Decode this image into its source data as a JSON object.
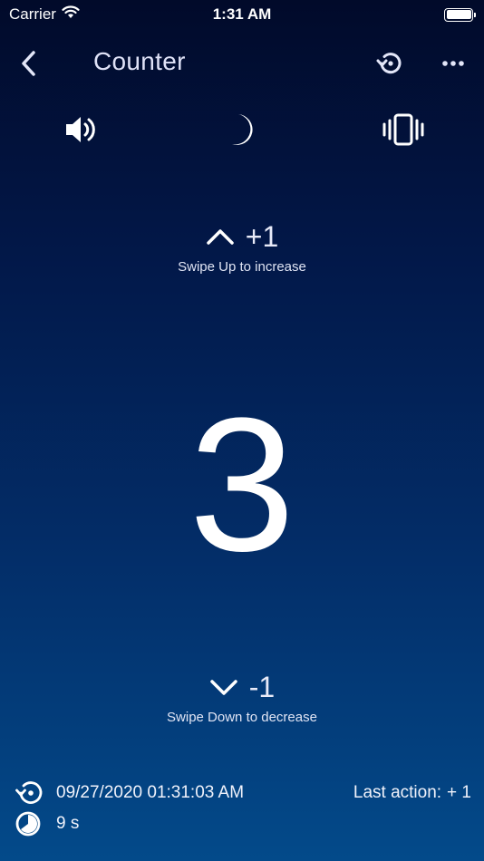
{
  "status_bar": {
    "carrier": "Carrier",
    "time": "1:31 AM"
  },
  "nav": {
    "title": "Counter"
  },
  "increase": {
    "delta": "+1",
    "hint": "Swipe Up to increase"
  },
  "counter": {
    "value": "3"
  },
  "decrease": {
    "delta": "-1",
    "hint": "Swipe Down to decrease"
  },
  "footer": {
    "last_reset": "09/27/2020 01:31:03 AM",
    "elapsed": "9 s",
    "last_action_label": "Last action:",
    "last_action_value": "+ 1"
  },
  "colors": {
    "background_top": "#010a2a",
    "background_bottom": "#034a8a",
    "text": "#ffffff"
  }
}
